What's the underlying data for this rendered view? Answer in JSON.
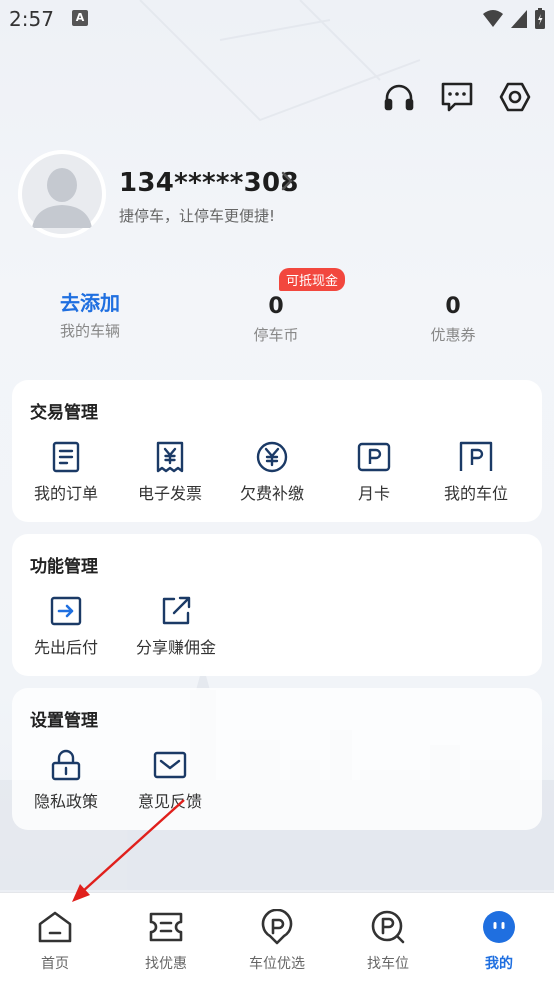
{
  "status_bar": {
    "time": "2:57",
    "notif_letter": "A"
  },
  "header_icons": [
    "headset-icon",
    "message-icon",
    "settings-icon"
  ],
  "profile": {
    "phone": "134*****308",
    "slogan": "捷停车，让停车更便捷!"
  },
  "stats": {
    "badge": "可抵现金",
    "items": [
      {
        "value": "去添加",
        "label": "我的车辆"
      },
      {
        "value": "0",
        "label": "停车币"
      },
      {
        "value": "0",
        "label": "优惠券"
      }
    ]
  },
  "sections": {
    "trade": {
      "title": "交易管理",
      "items": [
        {
          "label": "我的订单",
          "icon": "order-icon"
        },
        {
          "label": "电子发票",
          "icon": "invoice-icon"
        },
        {
          "label": "欠费补缴",
          "icon": "yuan-coin-icon"
        },
        {
          "label": "月卡",
          "icon": "parking-card-icon"
        },
        {
          "label": "我的车位",
          "icon": "parking-spot-icon"
        }
      ]
    },
    "function": {
      "title": "功能管理",
      "items": [
        {
          "label": "先出后付",
          "icon": "exit-arrow-icon"
        },
        {
          "label": "分享赚佣金",
          "icon": "share-icon"
        }
      ]
    },
    "settings": {
      "title": "设置管理",
      "items": [
        {
          "label": "隐私政策",
          "icon": "lock-icon"
        },
        {
          "label": "意见反馈",
          "icon": "mail-icon"
        }
      ]
    }
  },
  "tabbar": {
    "items": [
      {
        "label": "首页",
        "icon": "home-icon"
      },
      {
        "label": "找优惠",
        "icon": "ticket-icon"
      },
      {
        "label": "车位优选",
        "icon": "location-p-icon"
      },
      {
        "label": "找车位",
        "icon": "search-p-icon"
      },
      {
        "label": "我的",
        "icon": "profile-icon"
      }
    ],
    "active_index": 4
  },
  "colors": {
    "accent": "#1f6fe0",
    "badge": "#f2473e",
    "annotation_arrow": "#e0201c"
  }
}
